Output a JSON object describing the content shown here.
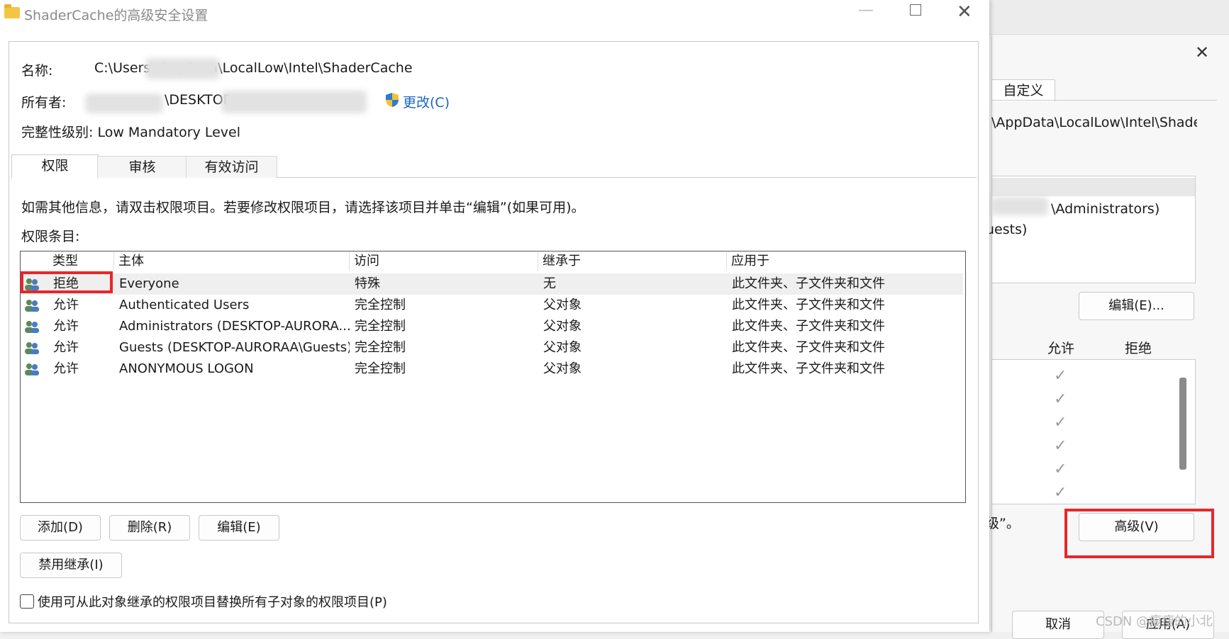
{
  "background_dialog": {
    "tab_custom": "自定义",
    "path": "\\AppData\\LocalLow\\Intel\\Shade",
    "user1": "\\Administrators)",
    "user2": "uests)",
    "edit_button": "编辑(E)...",
    "allow_header": "允许",
    "deny_header": "拒绝",
    "hint_tail": "级”。",
    "advanced_button": "高级(V)",
    "cancel_button": "取消",
    "apply_button": "应用(A)",
    "watermark": "CSDN @瘦瘦的小北"
  },
  "window": {
    "title": "ShaderCache的高级安全设置"
  },
  "header": {
    "name_label": "名称:",
    "name_value": "C:\\Users\\        AppData\\LocalLow\\Intel\\ShaderCache",
    "owner_label": "所有者:",
    "owner_value": "\\DESKTOP",
    "change_link": "更改(C)",
    "integrity": "完整性级别: Low Mandatory Level"
  },
  "tabs": [
    "权限",
    "审核",
    "有效访问"
  ],
  "info_text": "如需其他信息，请双击权限项目。若要修改权限项目，请选择该项目并单击“编辑”(如果可用)。",
  "entries_label": "权限条目:",
  "columns": [
    "类型",
    "主体",
    "访问",
    "继承于",
    "应用于"
  ],
  "rows": [
    {
      "type": "拒绝",
      "principal": "Everyone",
      "access": "特殊",
      "inherited": "无",
      "applies": "此文件夹、子文件夹和文件"
    },
    {
      "type": "允许",
      "principal": "Authenticated Users",
      "access": "完全控制",
      "inherited": "父对象",
      "applies": "此文件夹、子文件夹和文件"
    },
    {
      "type": "允许",
      "principal": "Administrators (DESKTOP-AURORA...",
      "access": "完全控制",
      "inherited": "父对象",
      "applies": "此文件夹、子文件夹和文件"
    },
    {
      "type": "允许",
      "principal": "Guests (DESKTOP-AURORAA\\Guests)",
      "access": "完全控制",
      "inherited": "父对象",
      "applies": "此文件夹、子文件夹和文件"
    },
    {
      "type": "允许",
      "principal": "ANONYMOUS LOGON",
      "access": "完全控制",
      "inherited": "父对象",
      "applies": "此文件夹、子文件夹和文件"
    }
  ],
  "buttons": {
    "add": "添加(D)",
    "remove": "删除(R)",
    "edit": "编辑(E)",
    "disable_inheritance": "禁用继承(I)"
  },
  "replace_checkbox_label": "使用可从此对象继承的权限项目替换所有子对象的权限项目(P)",
  "colors": {
    "highlight": "#e8262b",
    "link": "#1a63c6"
  }
}
